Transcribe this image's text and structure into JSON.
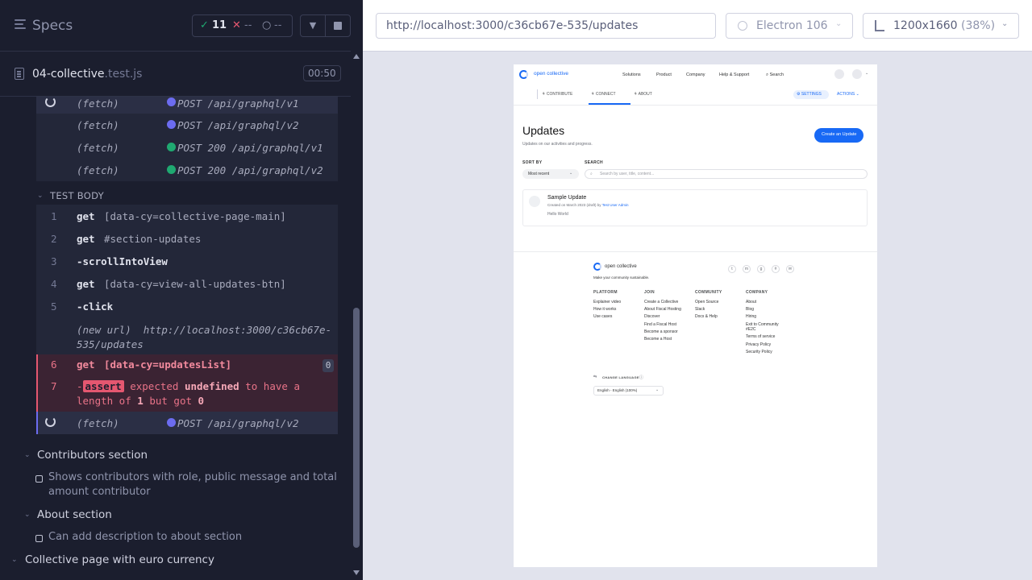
{
  "runner": {
    "specs_title": "Specs",
    "passed_count": "11",
    "failed_count": "--",
    "pending_count": "--",
    "spec_file": "04-collective",
    "spec_ext": ".test.js",
    "duration": "00:50"
  },
  "command_log": {
    "fetch_rows": [
      {
        "label": "(fetch)",
        "request": "POST /api/graphql/v1",
        "dot_color": "#6c6cf0",
        "spinner": true
      },
      {
        "label": "(fetch)",
        "request": "POST /api/graphql/v2",
        "dot_color": "#6c6cf0",
        "spinner": false
      },
      {
        "label": "(fetch)",
        "request": "POST 200 /api/graphql/v1",
        "dot_color": "#1fa971",
        "spinner": false
      },
      {
        "label": "(fetch)",
        "request": "POST 200 /api/graphql/v2",
        "dot_color": "#1fa971",
        "spinner": false
      }
    ],
    "test_body_label": "TEST BODY",
    "commands": [
      {
        "num": "1",
        "cmd": "get",
        "arg": "[data-cy=collective-page-main]"
      },
      {
        "num": "2",
        "cmd": "get",
        "arg": "#section-updates"
      },
      {
        "num": "3",
        "cmd": "-scrollIntoView",
        "arg": ""
      },
      {
        "num": "4",
        "cmd": "get",
        "arg": "[data-cy=view-all-updates-btn]"
      },
      {
        "num": "5",
        "cmd": "-click",
        "arg": ""
      }
    ],
    "new_url_label": "(new url)",
    "new_url_1": "http://localhost:3000/c36cb67e-",
    "new_url_2": "535/updates",
    "failed_command": {
      "num": "6",
      "cmd": "get",
      "arg": "[data-cy=updatesList]",
      "count": "0"
    },
    "assert": {
      "num": "7",
      "prefix": "-",
      "badge": "assert",
      "w1": "expected",
      "w2": "undefined",
      "w3": "to have a",
      "w4": "length of",
      "w5": "1",
      "w6": "but got",
      "w7": "0"
    },
    "last_fetch": {
      "label": "(fetch)",
      "request": "POST /api/graphql/v2",
      "dot_color": "#6c6cf0"
    }
  },
  "suites": [
    {
      "title": "Contributors section",
      "test": "Shows contributors with role, public message and total",
      "test2": "amount contributor"
    },
    {
      "title": "About section",
      "test": "Can add description to about section"
    }
  ],
  "next_suite": "Collective page with euro currency",
  "aut": {
    "url": "http://localhost:3000/c36cb67e-535/updates",
    "browser": "Electron 106",
    "viewport": "1200x1660",
    "scale": "(38%)"
  },
  "page": {
    "logo": "open collective",
    "nav": [
      "Solutions",
      "Product",
      "Company",
      "Help & Support"
    ],
    "search": "Search",
    "subnav": [
      "CONTRIBUTE",
      "CONNECT",
      "ABOUT"
    ],
    "settings": "SETTINGS",
    "actions": "ACTIONS",
    "title": "Updates",
    "subtitle": "Updates on our activities and progress.",
    "create_btn": "Create an Update",
    "sort_label": "SORT BY",
    "sort_value": "Most recent",
    "search_label": "SEARCH",
    "search_placeholder": "Search by user, title, content...",
    "update_title": "Sample Update",
    "update_meta_prefix": "Created on March 2023 (draft) by",
    "update_author": "Test User Admin",
    "update_body": "Hello World",
    "footer_logo": "open collective",
    "footer_tagline": "Make your community sustainable.",
    "footer_cols": [
      {
        "title": "PLATFORM",
        "items": [
          "Explainer video",
          "How it works",
          "Use cases"
        ]
      },
      {
        "title": "JOIN",
        "items": [
          "Create a Collective",
          "About Fiscal Hosting",
          "Discover",
          "Find a Fiscal Host",
          "Become a sponsor",
          "Become a Host"
        ]
      },
      {
        "title": "COMMUNITY",
        "items": [
          "Open Source",
          "Slack",
          "Docs & Help"
        ]
      },
      {
        "title": "COMPANY",
        "items": [
          "About",
          "Blog",
          "Hiring",
          "Exit to Community",
          "#E2C",
          "Terms of service",
          "Privacy Policy",
          "Security Policy"
        ]
      }
    ],
    "language_label": "CHANGE LANGUAGE",
    "language_value": "English - English (100%)"
  }
}
